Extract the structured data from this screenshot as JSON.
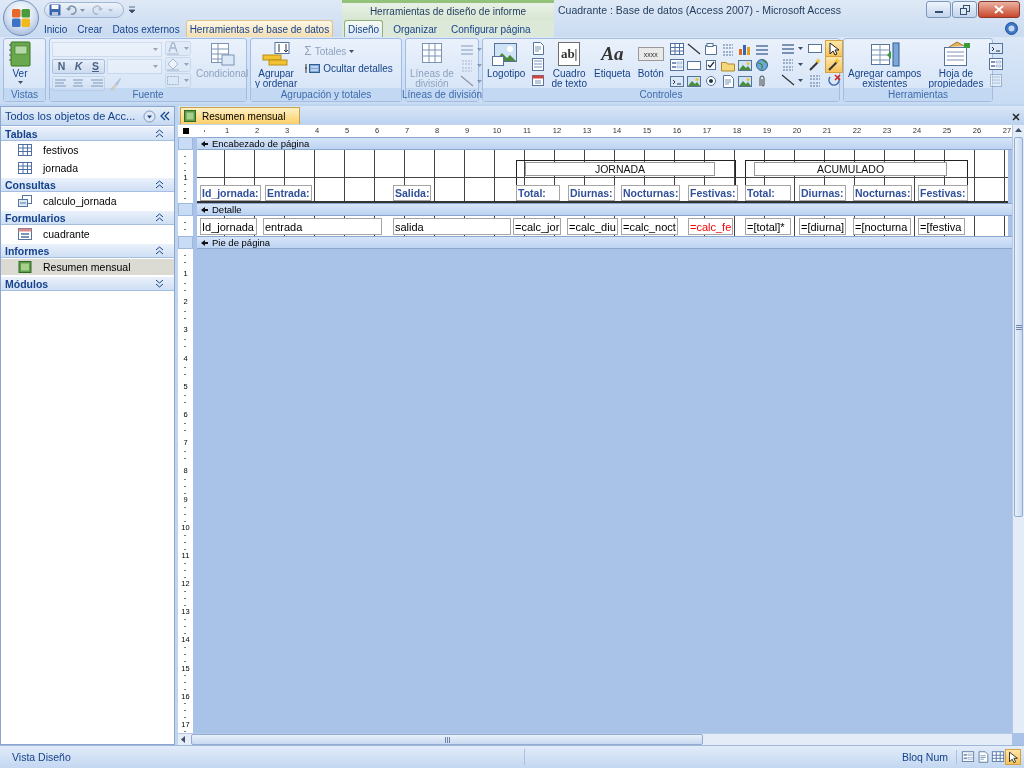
{
  "title_bar": {
    "context_label": "Herramientas de diseño de informe",
    "title": "Cuadrante : Base de datos (Access 2007) - Microsoft Access"
  },
  "tabs": [
    {
      "label": "Inicio",
      "kind": "standard",
      "selected": false,
      "hovered": false
    },
    {
      "label": "Crear",
      "kind": "standard",
      "selected": false,
      "hovered": false
    },
    {
      "label": "Datos externos",
      "kind": "standard",
      "selected": false,
      "hovered": false
    },
    {
      "label": "Herramientas de base de datos",
      "kind": "standard",
      "selected": false,
      "hovered": true
    },
    {
      "label": "Diseño",
      "kind": "context",
      "selected": true,
      "hovered": false
    },
    {
      "label": "Organizar",
      "kind": "context",
      "selected": false,
      "hovered": false
    },
    {
      "label": "Configurar página",
      "kind": "context",
      "selected": false,
      "hovered": false
    }
  ],
  "ribbon": [
    {
      "kind": "views",
      "title": "Vistas",
      "label": "Ver"
    },
    {
      "kind": "font",
      "title": "Fuente",
      "disabled": true,
      "format_buttons": [
        {
          "label": "N",
          "kind": "bold"
        },
        {
          "label": "K",
          "kind": "italic"
        },
        {
          "label": "S",
          "kind": "underline"
        }
      ],
      "conditional": "Condicional"
    },
    {
      "kind": "grouping",
      "title": "Agrupación y totales",
      "sort_label": "Agrupar\ny ordenar",
      "small": [
        {
          "glyph": "Σ",
          "label": "Totales",
          "disabled": true
        },
        {
          "label": "Ocultar detalles",
          "disabled": false
        }
      ]
    },
    {
      "kind": "gridlines",
      "title": "Líneas de división",
      "label": "Líneas de\ndivisión",
      "disabled": true
    },
    {
      "kind": "controls",
      "title": "Controles",
      "buttons": [
        {
          "label": "Logotipo"
        },
        {
          "label": "Cuadro\nde texto",
          "glyph": "ab|"
        },
        {
          "label": "Etiqueta",
          "glyph": "Aa"
        },
        {
          "label": "Botón",
          "glyph": "xxxx"
        }
      ],
      "tools": [
        {
          "selected": true
        },
        {
          "selected": true
        },
        {
          "selected": false
        }
      ]
    },
    {
      "kind": "tools",
      "title": "Herramientas",
      "buttons": [
        {
          "label": "Agregar campos\nexistentes"
        },
        {
          "label": "Hoja de\npropiedades"
        }
      ]
    }
  ],
  "navigation": {
    "title": "Todos los objetos de Acc...",
    "groups": [
      {
        "label": "Tablas",
        "expanded": true,
        "items": [
          {
            "label": "festivos",
            "kind": "table",
            "selected": false
          },
          {
            "label": "jornada",
            "kind": "table",
            "selected": false
          }
        ]
      },
      {
        "label": "Consultas",
        "expanded": true,
        "items": [
          {
            "label": "calculo_jornada",
            "kind": "query",
            "selected": false
          }
        ]
      },
      {
        "label": "Formularios",
        "expanded": true,
        "items": [
          {
            "label": "cuadrante",
            "kind": "form",
            "selected": false
          }
        ]
      },
      {
        "label": "Informes",
        "expanded": true,
        "items": [
          {
            "label": "Resumen mensual",
            "kind": "report",
            "selected": true
          }
        ]
      },
      {
        "label": "Módulos",
        "expanded": false
      }
    ]
  },
  "document": {
    "tab": "Resumen mensual",
    "ruler": [
      "1",
      "2",
      "3",
      "4",
      "5",
      "6",
      "7",
      "8",
      "9",
      "10",
      "11",
      "12",
      "13",
      "14",
      "15",
      "16",
      "17",
      "18",
      "19",
      "20",
      "21",
      "22",
      "23",
      "24",
      "25",
      "26",
      "27"
    ],
    "header_ruler": [
      "1"
    ],
    "vertical_ruler": [
      "1",
      "2",
      "3",
      "4",
      "5",
      "6",
      "7",
      "8",
      "9",
      "10",
      "11",
      "12",
      "13",
      "14",
      "15",
      "16",
      "17"
    ],
    "sections": [
      {
        "label": "Encabezado de página",
        "kind": "header"
      },
      {
        "label": "Detalle",
        "kind": "detail"
      },
      {
        "label": "Pie de página",
        "kind": "footer"
      }
    ],
    "header_groups": [
      "JORNADA",
      "ACUMULADO"
    ],
    "header_labels": [
      "Id_jornada:",
      "Entrada:",
      "Salida:",
      "Total:",
      "Diurnas:",
      "Nocturnas:",
      "Festivas:",
      "Total:",
      "Diurnas:",
      "Nocturnas:",
      "Festivas:"
    ],
    "detail_fields": [
      {
        "text": "Id_jornada",
        "color": "#000000"
      },
      {
        "text": "entrada",
        "color": "#000000"
      },
      {
        "text": "salida",
        "color": "#000000"
      },
      {
        "text": "=calc_jor",
        "color": "#000000"
      },
      {
        "text": "=calc_diu",
        "color": "#000000"
      },
      {
        "text": "=calc_noct",
        "color": "#000000"
      },
      {
        "text": "=calc_fe",
        "color": "#ff0000"
      },
      {
        "text": "=[total]*",
        "color": "#000000"
      },
      {
        "text": "=[diurna]",
        "color": "#000000"
      },
      {
        "text": "=[nocturna",
        "color": "#000000"
      },
      {
        "text": "=[festiva",
        "color": "#000000"
      }
    ]
  },
  "status_bar": {
    "text": "Vista Diseño",
    "indicator": "Bloq Num",
    "views": [
      {
        "selected": false
      },
      {
        "selected": false
      },
      {
        "selected": false
      },
      {
        "selected": true
      }
    ]
  }
}
